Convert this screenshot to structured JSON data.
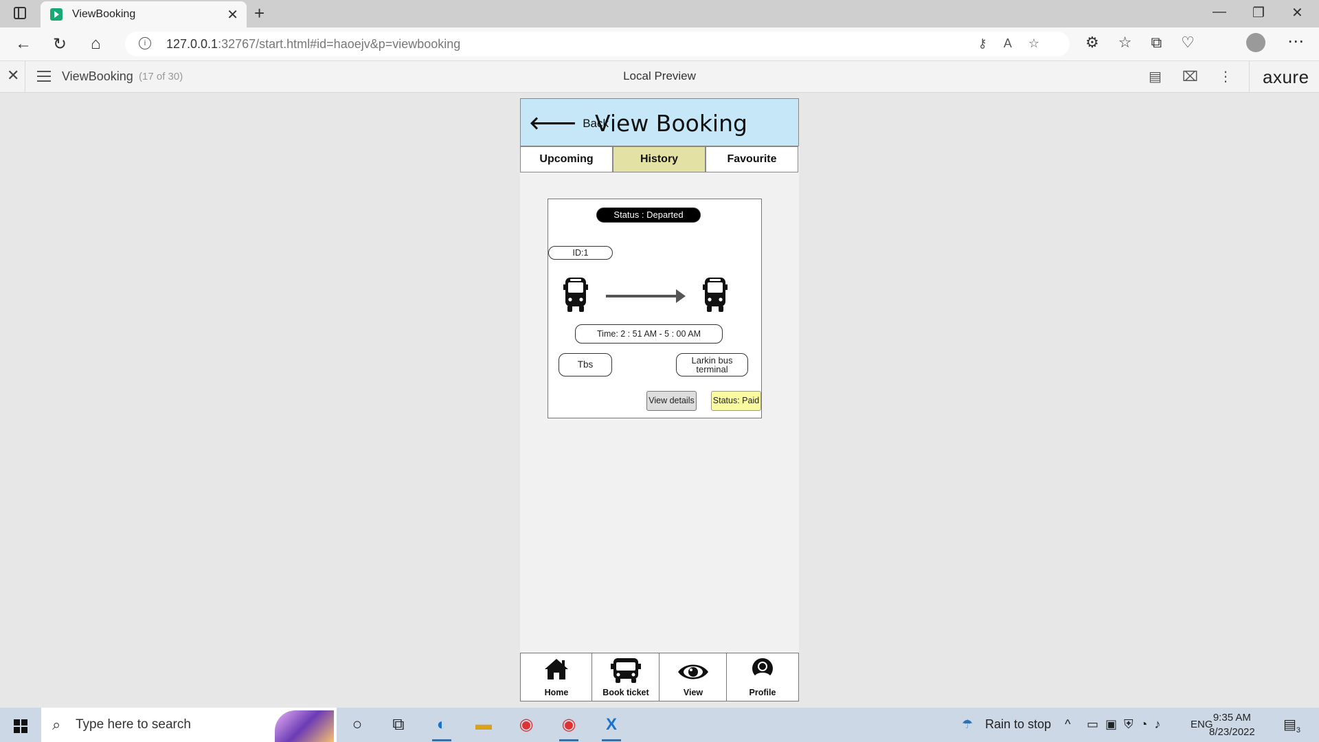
{
  "browser": {
    "tab_title": "ViewBooking",
    "url_host": "127.0.0.1",
    "url_rest": ":32767/start.html#id=haoejv&p=viewbooking"
  },
  "axure": {
    "page_name": "ViewBooking",
    "page_count": "(17 of 30)",
    "center_label": "Local Preview",
    "logo": "axure"
  },
  "app": {
    "header": {
      "back_label": "Back",
      "title": "View Booking"
    },
    "tabs": [
      {
        "label": "Upcoming",
        "active": false
      },
      {
        "label": "History",
        "active": true
      },
      {
        "label": "Favourite",
        "active": false
      }
    ],
    "booking": {
      "status": "Status : Departed",
      "id": "ID:1",
      "time": "Time: 2 : 51 AM - 5 : 00 AM",
      "from": "Tbs",
      "to": "Larkin bus terminal",
      "details_button": "View details",
      "payment_status": "Status: Paid"
    },
    "bottom_nav": [
      {
        "label": "Home",
        "icon": "home-icon"
      },
      {
        "label": "Book ticket",
        "icon": "bus-icon"
      },
      {
        "label": "View",
        "icon": "eye-icon"
      },
      {
        "label": "Profile",
        "icon": "user-icon"
      }
    ],
    "colors": {
      "header_bg": "#c6e7f7",
      "active_tab": "#e4e1a4",
      "paid_badge": "#fafaa0"
    }
  },
  "taskbar": {
    "search_placeholder": "Type here to search",
    "weather": "Rain to stop",
    "language": "ENG",
    "time": "9:35 AM",
    "date": "8/23/2022",
    "notification_count": "3"
  }
}
